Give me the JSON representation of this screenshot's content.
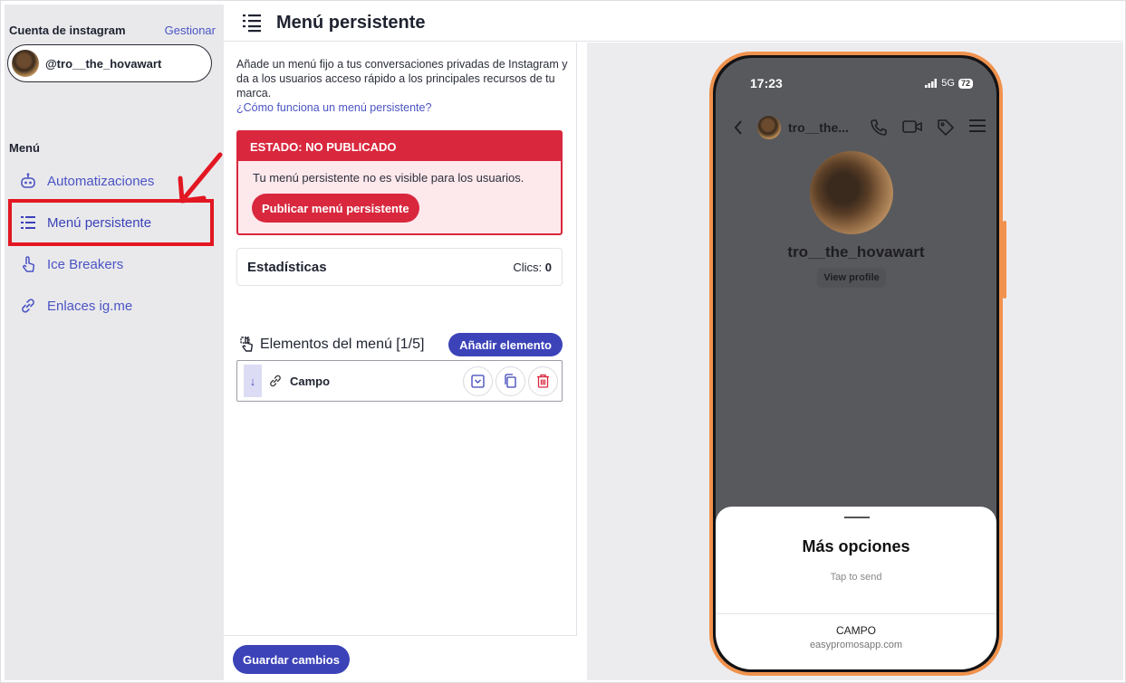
{
  "sidebar": {
    "account_label": "Cuenta de instagram",
    "manage_link": "Gestionar",
    "account_handle": "@tro__the_hovawart",
    "menu_title": "Menú",
    "items": [
      {
        "label": "Automatizaciones",
        "icon": "robot-icon"
      },
      {
        "label": "Menú persistente",
        "icon": "list-icon",
        "active": true
      },
      {
        "label": "Ice Breakers",
        "icon": "tap-icon"
      },
      {
        "label": "Enlaces ig.me",
        "icon": "link-icon"
      }
    ]
  },
  "header": {
    "title": "Menú persistente",
    "icon": "list-icon"
  },
  "main": {
    "description": "Añade un menú fijo a tus conversaciones privadas de Instagram y da a los usuarios acceso rápido a los principales recursos de tu marca.",
    "help_link": "¿Cómo funciona un menú persistente?",
    "status": {
      "title": "ESTADO: NO PUBLICADO",
      "message": "Tu menú persistente no es visible para los usuarios.",
      "publish_button": "Publicar menú persistente"
    },
    "stats": {
      "title": "Estadísticas",
      "clicks_label": "Clics:",
      "clicks_value": "0"
    },
    "elements": {
      "title": "Elementos del menú [1/5]",
      "add_button": "Añadir elemento",
      "items": [
        {
          "name": "Campo"
        }
      ]
    },
    "save_button": "Guardar cambios"
  },
  "preview": {
    "time": "17:23",
    "network": "5G",
    "battery": "72",
    "chat_name": "tro__the...",
    "profile_name": "tro__the_hovawart",
    "view_profile": "View profile",
    "sheet": {
      "title": "Más opciones",
      "subtitle": "Tap to send",
      "item_label": "CAMPO",
      "item_url": "easypromosapp.com"
    }
  },
  "colors": {
    "accent": "#3c43b8",
    "danger": "#d9283e",
    "highlight": "#e21722",
    "phone_frame": "#f0924d"
  }
}
